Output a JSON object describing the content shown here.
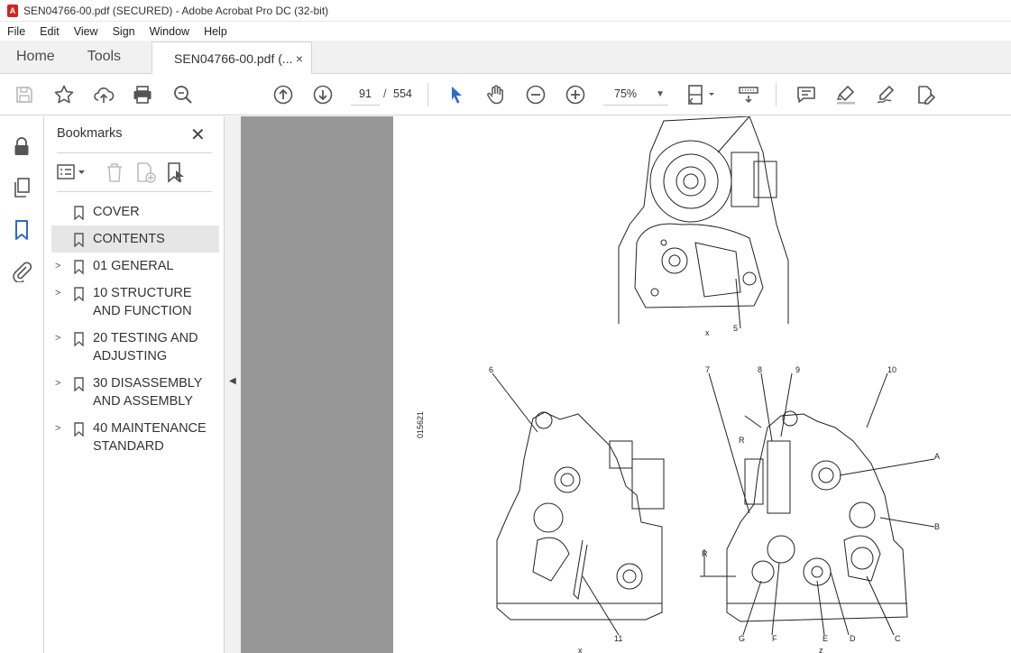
{
  "window": {
    "title": "SEN04766-00.pdf (SECURED) - Adobe Acrobat Pro DC (32-bit)"
  },
  "menu": [
    "File",
    "Edit",
    "View",
    "Sign",
    "Window",
    "Help"
  ],
  "tabs": {
    "home": "Home",
    "tools": "Tools",
    "document": "SEN04766-00.pdf (...",
    "close": "×"
  },
  "toolbar": {
    "current_page": "91",
    "page_separator": "/",
    "total_pages": "554",
    "zoom": "75%",
    "icons": [
      "save-icon",
      "star-icon",
      "upload-icon",
      "print-icon",
      "search-zoom-icon",
      "page-up-icon",
      "page-down-icon",
      "select-pointer-icon",
      "hand-icon",
      "zoom-out-icon",
      "zoom-in-icon",
      "page-fit-icon",
      "scroll-mode-icon",
      "comment-icon",
      "highlight-icon",
      "sign-icon",
      "edit-pdf-icon"
    ]
  },
  "bookmarks": {
    "title": "Bookmarks",
    "items": [
      {
        "label": "COVER",
        "expandable": false,
        "selected": false
      },
      {
        "label": "CONTENTS",
        "expandable": false,
        "selected": true
      },
      {
        "label": "01 GENERAL",
        "expandable": true,
        "selected": false
      },
      {
        "label": "10 STRUCTURE AND FUNCTION",
        "expandable": true,
        "selected": false
      },
      {
        "label": "20 TESTING AND ADJUSTING",
        "expandable": true,
        "selected": false
      },
      {
        "label": "30 DISASSEMBLY AND ASSEMBLY",
        "expandable": true,
        "selected": false
      },
      {
        "label": "40 MAINTENANCE STANDARD",
        "expandable": true,
        "selected": false
      }
    ]
  },
  "document_page": {
    "figure_id": "015621",
    "labels_top": [
      "x",
      "5"
    ],
    "labels_left": [
      "6",
      "11",
      "x"
    ],
    "labels_right": [
      "7",
      "8",
      "9",
      "10",
      "R",
      "A",
      "B",
      "C",
      "D",
      "E",
      "F",
      "G",
      "R",
      "z"
    ]
  },
  "colors": {
    "accent": "#2d6bc4",
    "app_red": "#d6221b",
    "viewport_gray": "#979797"
  }
}
